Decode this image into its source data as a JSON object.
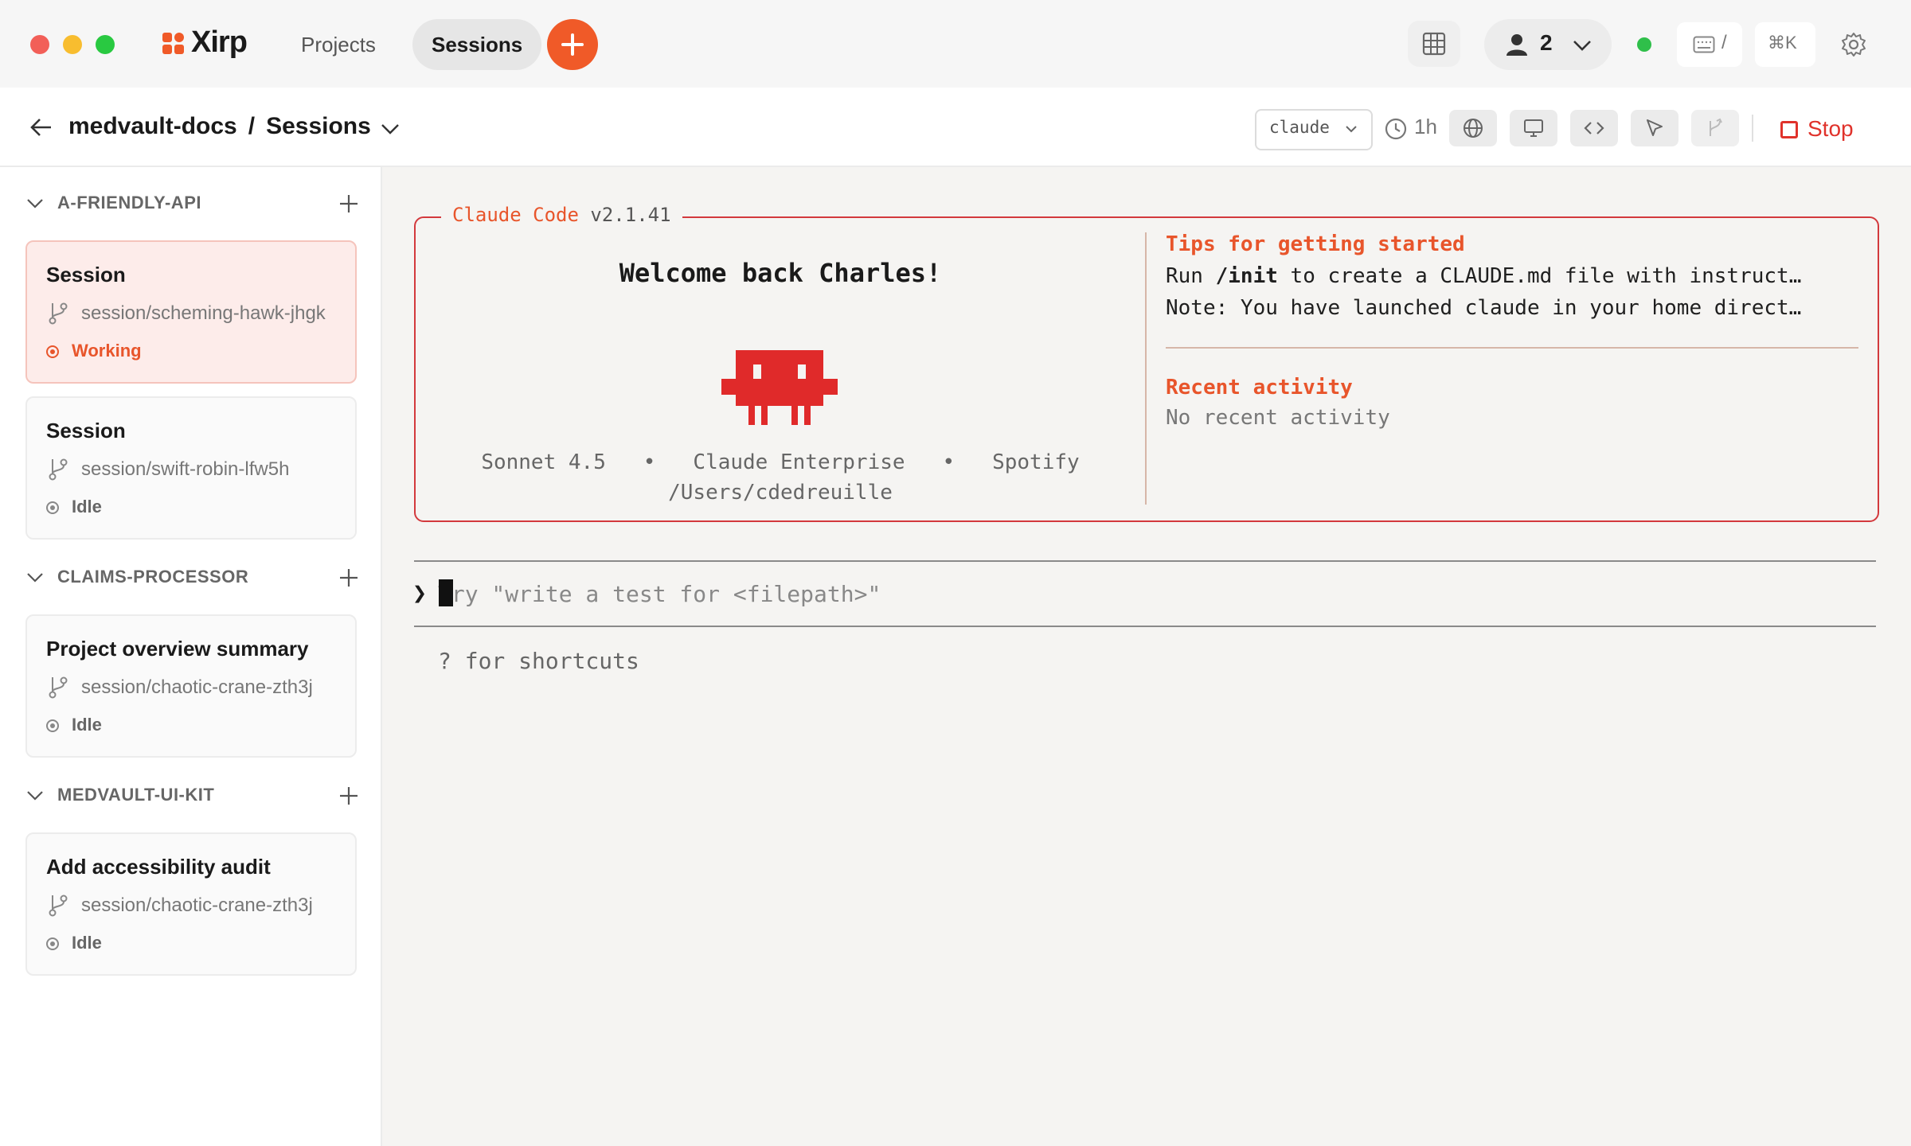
{
  "window": {
    "traffic_lights": [
      "#f25f58",
      "#f8bd2f",
      "#29c941"
    ]
  },
  "app": {
    "name": "Xirp",
    "brand_color": "#f05a28"
  },
  "nav": {
    "tabs": [
      {
        "label": "Projects",
        "active": false
      },
      {
        "label": "Sessions",
        "active": true
      }
    ],
    "new_button_icon": "plus-icon"
  },
  "topbar": {
    "users_count": "2",
    "status": "online",
    "kbd_shortcut": "/",
    "command_shortcut": "⌘K",
    "icons": [
      "grid-icon",
      "user-icon",
      "chevron-down-icon",
      "keyboard-icon",
      "settings-icon"
    ]
  },
  "subbar": {
    "project": "medvault-docs",
    "separator": "/",
    "section": "Sessions",
    "model": "claude",
    "timer": "1h",
    "stop_label": "Stop",
    "stop_color": "#e0322b",
    "tool_icons": [
      "globe-icon",
      "monitor-icon",
      "code-icon",
      "cursor-icon",
      "branch-icon"
    ]
  },
  "sidebar": {
    "groups": [
      {
        "name": "A-FRIENDLY-API",
        "sessions": [
          {
            "title": "Session",
            "branch": "session/scheming-hawk-jhgk",
            "status": "Working",
            "active": true
          },
          {
            "title": "Session",
            "branch": "session/swift-robin-lfw5h",
            "status": "Idle",
            "active": false
          }
        ]
      },
      {
        "name": "CLAIMS-PROCESSOR",
        "sessions": [
          {
            "title": "Project overview summary",
            "branch": "session/chaotic-crane-zth3j",
            "status": "Idle",
            "active": false
          }
        ]
      },
      {
        "name": "MEDVAULT-UI-KIT",
        "sessions": [
          {
            "title": "Add accessibility audit",
            "branch": "session/chaotic-crane-zth3j",
            "status": "Idle",
            "active": false
          }
        ]
      }
    ]
  },
  "terminal": {
    "box_title": "Claude Code",
    "version": "v2.1.41",
    "welcome": "Welcome back Charles!",
    "meta": "Sonnet 4.5   •   Claude Enterprise   •   Spotify",
    "cwd": "/Users/cdedreuille",
    "tips_title": "Tips for getting started",
    "tip1_prefix": "Run ",
    "tip1_cmd": "/init",
    "tip1_suffix": " to create a CLAUDE.md file with instruct…",
    "tip2": "Note: You have launched claude in your home direct…",
    "recent_title": "Recent activity",
    "recent_text": "No recent activity",
    "prompt_symbol": "❯",
    "prompt_placeholder": "Try \"write a test for <filepath>\"",
    "shortcut_hint": "? for shortcuts",
    "accent_color": "#e8552b",
    "border_color": "#d3393d",
    "mascot_color": "#e02a2a"
  }
}
